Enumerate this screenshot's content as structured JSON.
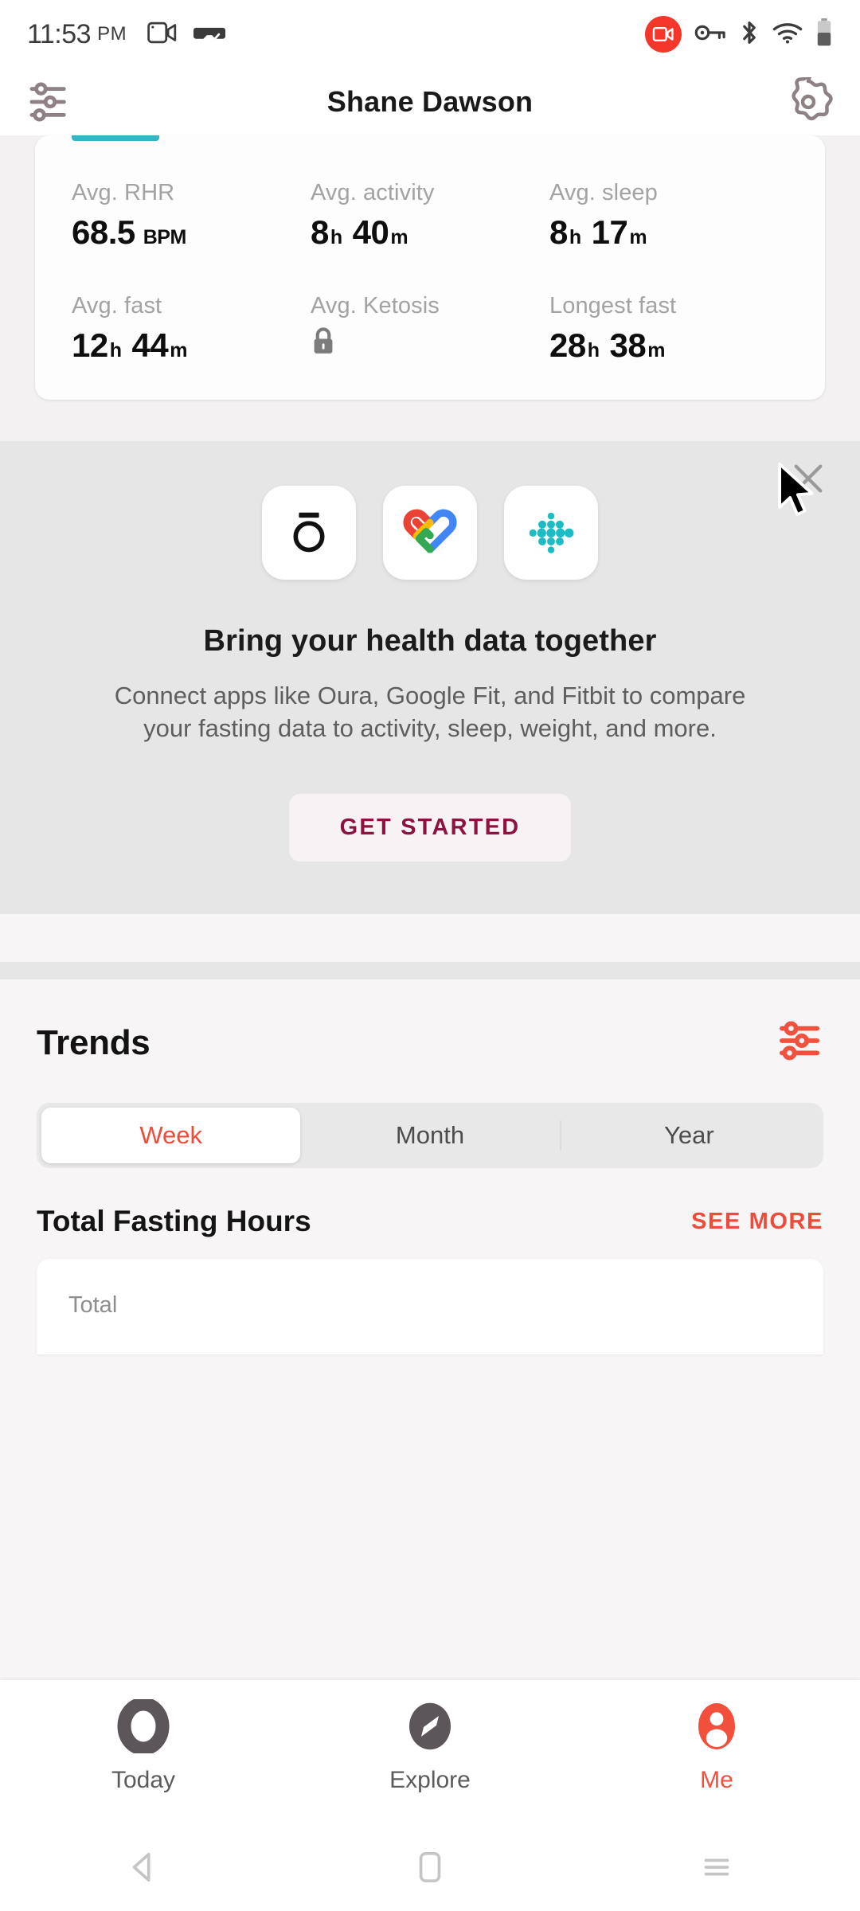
{
  "status_bar": {
    "time": "11:53",
    "ampm": "PM",
    "icons": [
      "screen-record-icon",
      "vr-headset-icon",
      "recording-badge-icon",
      "key-icon",
      "bluetooth-icon",
      "wifi-icon",
      "battery-icon"
    ]
  },
  "header": {
    "title": "Shane Dawson",
    "left_icon": "sliders-icon",
    "right_icon": "gear-icon"
  },
  "stats": {
    "items": [
      {
        "label": "Avg. RHR",
        "value": "68.5",
        "unit1": "BPM",
        "value2": "",
        "unit2": "",
        "locked": false
      },
      {
        "label": "Avg. activity",
        "value": "8",
        "unit1": "h",
        "value2": "40",
        "unit2": "m",
        "locked": false
      },
      {
        "label": "Avg. sleep",
        "value": "8",
        "unit1": "h",
        "value2": "17",
        "unit2": "m",
        "locked": false
      },
      {
        "label": "Avg. fast",
        "value": "12",
        "unit1": "h",
        "value2": "44",
        "unit2": "m",
        "locked": false
      },
      {
        "label": "Avg. Ketosis",
        "value": "",
        "unit1": "",
        "value2": "",
        "unit2": "",
        "locked": true
      },
      {
        "label": "Longest fast",
        "value": "28",
        "unit1": "h",
        "value2": "38",
        "unit2": "m",
        "locked": false
      }
    ]
  },
  "promo": {
    "apps": [
      "oura-icon",
      "google-fit-icon",
      "fitbit-icon"
    ],
    "title": "Bring your health data together",
    "subtitle": "Connect apps like Oura, Google Fit, and Fitbit to compare your fasting data to activity, sleep, weight, and more.",
    "cta_label": "GET STARTED",
    "close_icon": "close-icon"
  },
  "trends": {
    "title": "Trends",
    "filter_icon": "filter-sliders-icon",
    "ranges": [
      "Week",
      "Month",
      "Year"
    ],
    "active_range": "Week",
    "section_title": "Total Fasting Hours",
    "see_more_label": "SEE MORE",
    "chart_label": "Total"
  },
  "bottom_nav": {
    "items": [
      {
        "label": "Today",
        "icon": "circle-icon",
        "active": false
      },
      {
        "label": "Explore",
        "icon": "compass-icon",
        "active": false
      },
      {
        "label": "Me",
        "icon": "person-icon",
        "active": true
      }
    ]
  },
  "android_nav": {
    "back": "back-triangle-icon",
    "home": "home-square-icon",
    "recents": "recents-menu-icon"
  },
  "colors": {
    "accent": "#ef4b3a",
    "cta_text": "#8d1141",
    "tab_underline": "#35b6c6",
    "record_red": "#f4362b"
  }
}
